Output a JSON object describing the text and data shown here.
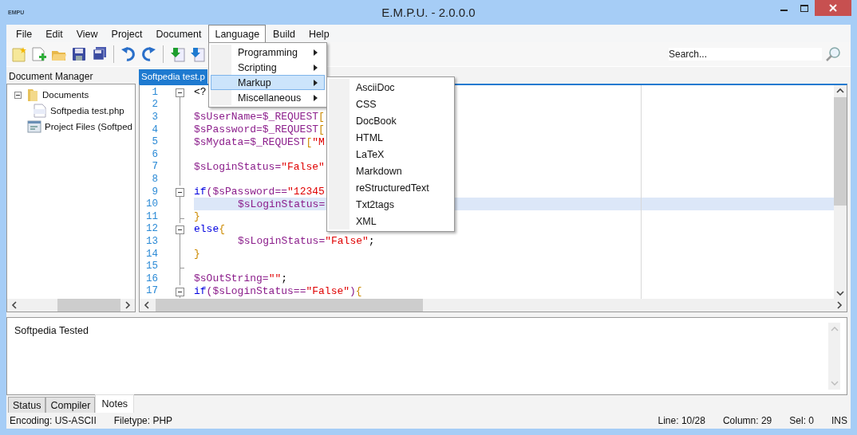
{
  "window": {
    "title": "E.M.P.U. - 2.0.0.0",
    "app_icon_text": "EMPU"
  },
  "menu_bar": [
    {
      "label": "File",
      "selected": false
    },
    {
      "label": "Edit",
      "selected": false
    },
    {
      "label": "View",
      "selected": false
    },
    {
      "label": "Project",
      "selected": false
    },
    {
      "label": "Document",
      "selected": false
    },
    {
      "label": "Language",
      "selected": true
    },
    {
      "label": "Build",
      "selected": false
    },
    {
      "label": "Help",
      "selected": false
    }
  ],
  "language_menu": {
    "items": [
      {
        "label": "Programming",
        "selected": false,
        "has_submenu": true
      },
      {
        "label": "Scripting",
        "selected": false,
        "has_submenu": true
      },
      {
        "label": "Markup",
        "selected": true,
        "has_submenu": true
      },
      {
        "label": "Miscellaneous",
        "selected": false,
        "has_submenu": true
      }
    ]
  },
  "markup_submenu": {
    "items": [
      "AsciiDoc",
      "CSS",
      "DocBook",
      "HTML",
      "LaTeX",
      "Markdown",
      "reStructuredText",
      "Txt2tags",
      "XML"
    ]
  },
  "search": {
    "placeholder": "Search..."
  },
  "document_manager": {
    "title": "Document Manager",
    "tree": [
      {
        "label": "Documents",
        "kind": "folder",
        "expanded": true,
        "children": [
          {
            "label": "Softpedia test.php",
            "kind": "php"
          }
        ]
      },
      {
        "label": "Project Files (Softped",
        "kind": "project"
      }
    ]
  },
  "editor": {
    "tab": "Softpedia test.p",
    "lines": [
      {
        "number": "1",
        "kind": "foldstart",
        "selected": false,
        "indented": false,
        "tokens": [
          {
            "kind": "plain",
            "text": "<?"
          }
        ]
      },
      {
        "number": "2",
        "kind": "body",
        "selected": false
      },
      {
        "number": "3",
        "kind": "body",
        "selected": false,
        "indented": false,
        "tokens": [
          {
            "kind": "variable",
            "text": "$sUserName=$_REQUEST"
          },
          {
            "kind": "brace",
            "text": "["
          }
        ]
      },
      {
        "number": "4",
        "kind": "body",
        "selected": false,
        "indented": false,
        "tokens": [
          {
            "kind": "variable",
            "text": "$sPassword=$_REQUEST"
          },
          {
            "kind": "brace",
            "text": "["
          }
        ]
      },
      {
        "number": "5",
        "kind": "body",
        "selected": false,
        "indented": false,
        "tokens": [
          {
            "kind": "variable",
            "text": "$sMydata=$_REQUEST"
          },
          {
            "kind": "brace",
            "text": "["
          },
          {
            "kind": "string",
            "text": "\"M"
          }
        ]
      },
      {
        "number": "6",
        "kind": "body",
        "selected": false
      },
      {
        "number": "7",
        "kind": "body",
        "selected": false,
        "indented": false,
        "tokens": [
          {
            "kind": "variable",
            "text": "$sLoginStatus="
          },
          {
            "kind": "string",
            "text": "\"False\""
          }
        ]
      },
      {
        "number": "8",
        "kind": "body",
        "selected": false
      },
      {
        "number": "9",
        "kind": "foldstart",
        "selected": false,
        "indented": false,
        "tokens": [
          {
            "kind": "keyword",
            "text": "if"
          },
          {
            "kind": "variable",
            "text": "($sPassword=="
          },
          {
            "kind": "string",
            "text": "\"12345"
          }
        ]
      },
      {
        "number": "10",
        "kind": "body",
        "selected": true,
        "indented": true,
        "tokens": [
          {
            "kind": "variable",
            "text": "$sLoginStatus="
          }
        ]
      },
      {
        "number": "11",
        "kind": "foldend",
        "selected": false,
        "indented": false,
        "tokens": [
          {
            "kind": "brace",
            "text": "}"
          }
        ]
      },
      {
        "number": "12",
        "kind": "foldstart",
        "selected": false,
        "indented": false,
        "tokens": [
          {
            "kind": "keyword",
            "text": "else"
          },
          {
            "kind": "brace",
            "text": "{"
          }
        ]
      },
      {
        "number": "13",
        "kind": "body",
        "selected": false,
        "indented": true,
        "tokens": [
          {
            "kind": "variable",
            "text": "$sLoginStatus="
          },
          {
            "kind": "string",
            "text": "\"False\""
          },
          {
            "kind": "plain",
            "text": ";"
          }
        ]
      },
      {
        "number": "14",
        "kind": "body",
        "selected": false,
        "indented": false,
        "tokens": [
          {
            "kind": "brace",
            "text": "}"
          }
        ]
      },
      {
        "number": "15",
        "kind": "foldend",
        "selected": false
      },
      {
        "number": "16",
        "kind": "body",
        "selected": false,
        "indented": false,
        "tokens": [
          {
            "kind": "variable",
            "text": "$sOutString="
          },
          {
            "kind": "string",
            "text": "\"\""
          },
          {
            "kind": "plain",
            "text": ";"
          }
        ]
      },
      {
        "number": "17",
        "kind": "foldstart",
        "selected": false,
        "indented": false,
        "tokens": [
          {
            "kind": "keyword",
            "text": "if"
          },
          {
            "kind": "variable",
            "text": "($sLoginStatus=="
          },
          {
            "kind": "string",
            "text": "\"False\""
          },
          {
            "kind": "variable",
            "text": ")"
          },
          {
            "kind": "brace",
            "text": "{"
          }
        ]
      }
    ]
  },
  "notes": {
    "text": "Softpedia Tested"
  },
  "bottom_tabs": [
    {
      "label": "Status",
      "selected": false
    },
    {
      "label": "Compiler",
      "selected": false
    },
    {
      "label": "Notes",
      "selected": true
    }
  ],
  "status_bar": {
    "left": [
      "Encoding: US-ASCII",
      "Filetype: PHP"
    ],
    "right": [
      "Line: 10/28",
      "Column: 29",
      "Sel: 0",
      "INS"
    ]
  }
}
